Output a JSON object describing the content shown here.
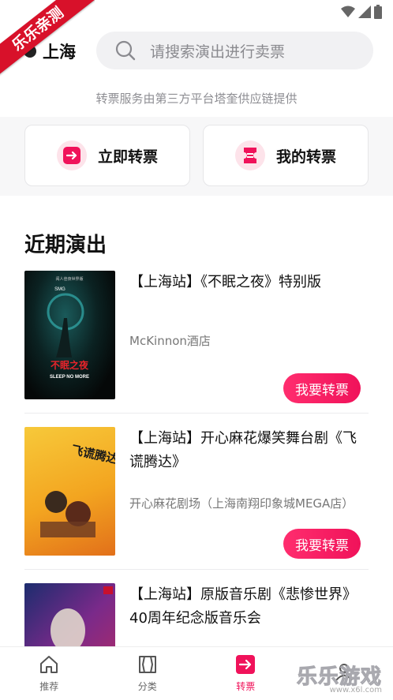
{
  "ribbon": {
    "text": "乐乐亲测"
  },
  "header": {
    "city": "上海",
    "search_placeholder": "请搜索演出进行卖票"
  },
  "notice": "转票服务由第三方平台塔奎供应链提供",
  "actions": [
    {
      "label": "立即转票",
      "icon": "arrow-right-icon"
    },
    {
      "label": "我的转票",
      "icon": "ticket-icon"
    }
  ],
  "section_title": "近期演出",
  "shows": [
    {
      "title": "【上海站】《不眠之夜》特别版",
      "venue": "McKinnon酒店",
      "button": "我要转票",
      "poster": {
        "top_text": "阅人佳夜世界版",
        "logo": "SMG",
        "main_text": "不眠之夜",
        "sub_text": "SLEEP NO MORE"
      }
    },
    {
      "title": "【上海站】开心麻花爆笑舞台剧《飞谎腾达》",
      "venue": "开心麻花剧场（上海南翔印象城MEGA店）",
      "button": "我要转票",
      "poster": {
        "main_text": "飞谎腾达"
      }
    },
    {
      "title": "【上海站】原版音乐剧《悲惨世界》40周年纪念版音乐会",
      "venue": "",
      "button": "",
      "poster": {}
    }
  ],
  "tabs": [
    {
      "label": "推荐",
      "icon": "home-icon",
      "active": false
    },
    {
      "label": "分类",
      "icon": "category-icon",
      "active": false
    },
    {
      "label": "转票",
      "icon": "transfer-icon",
      "active": true
    },
    {
      "label": "",
      "icon": "user-icon",
      "active": false
    }
  ],
  "watermark": {
    "text": "乐乐游戏",
    "sub": "www.x6l.com"
  },
  "colors": {
    "accent": "#f0125a",
    "ribbon": "#d8112a"
  }
}
